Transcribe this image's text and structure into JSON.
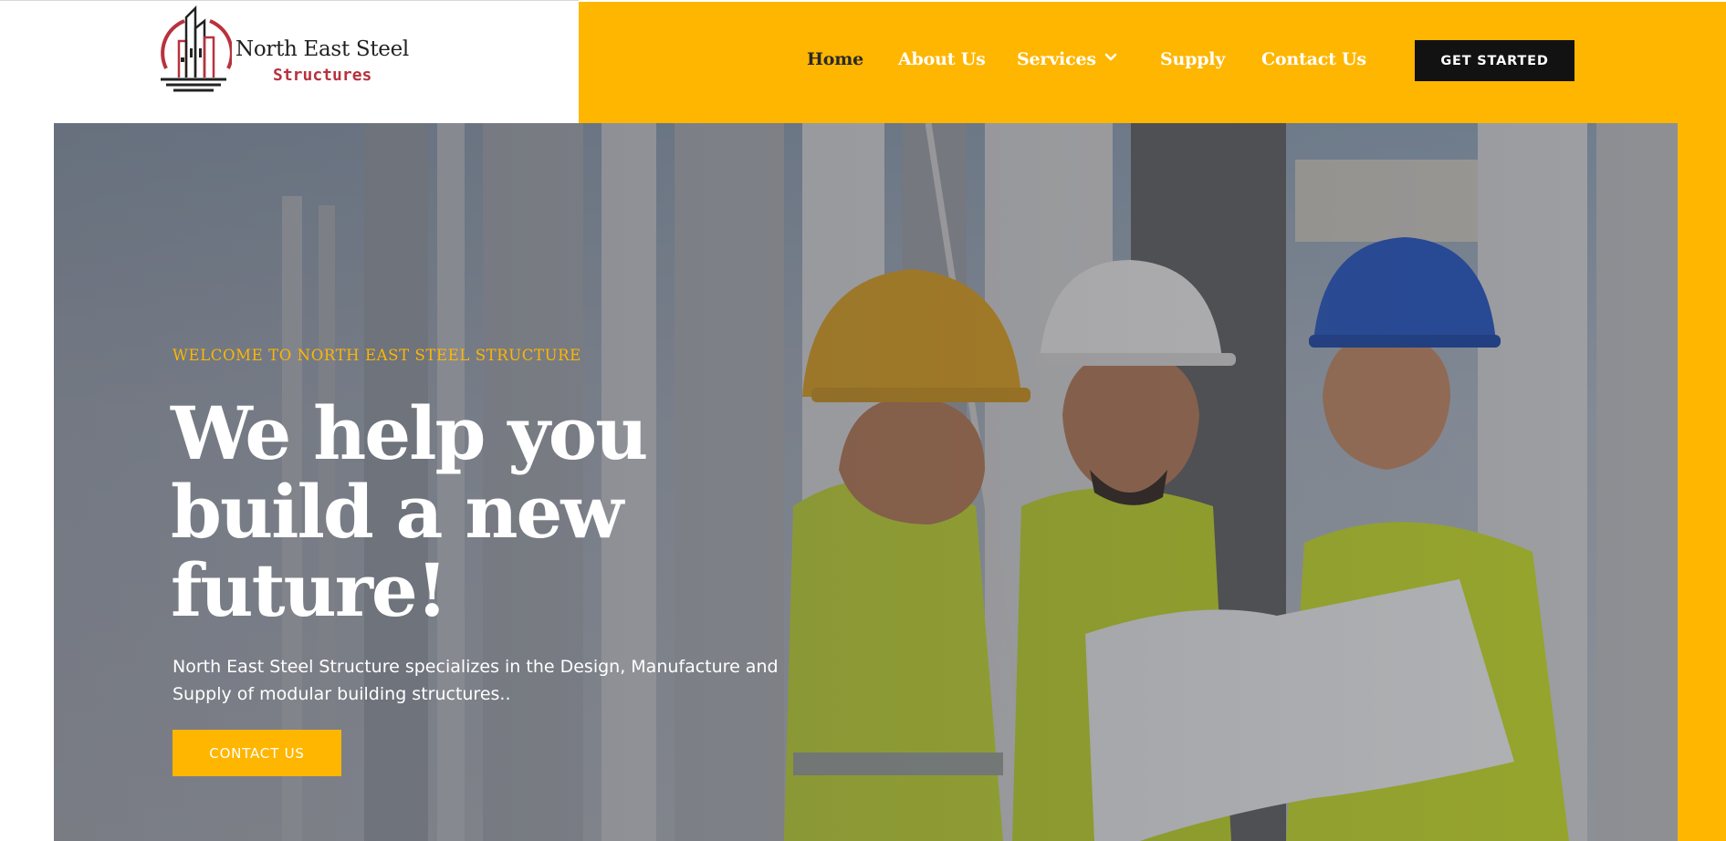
{
  "brand": {
    "name_line1": "North East Steel",
    "name_line2": "Structures"
  },
  "nav": {
    "items": [
      {
        "label": "Home"
      },
      {
        "label": "About Us"
      },
      {
        "label": "Services"
      },
      {
        "label": "Supply"
      },
      {
        "label": "Contact Us"
      }
    ],
    "cta_label": "GET STARTED"
  },
  "hero": {
    "welcome": "WELCOME TO NORTH EAST STEEL STRUCTURE",
    "headline": "We help you build a new future!",
    "description": "North East Steel Structure specializes in the Design, Manufacture and Supply of modular building structures..",
    "cta_label": "CONTACT US"
  },
  "icons": {
    "logo": "building-logo-icon",
    "services_dropdown": "chevron-down-icon"
  },
  "colors": {
    "accent": "#FFB600",
    "brand_red": "#B8323E",
    "dark": "#121212",
    "white": "#FFFFFF"
  }
}
